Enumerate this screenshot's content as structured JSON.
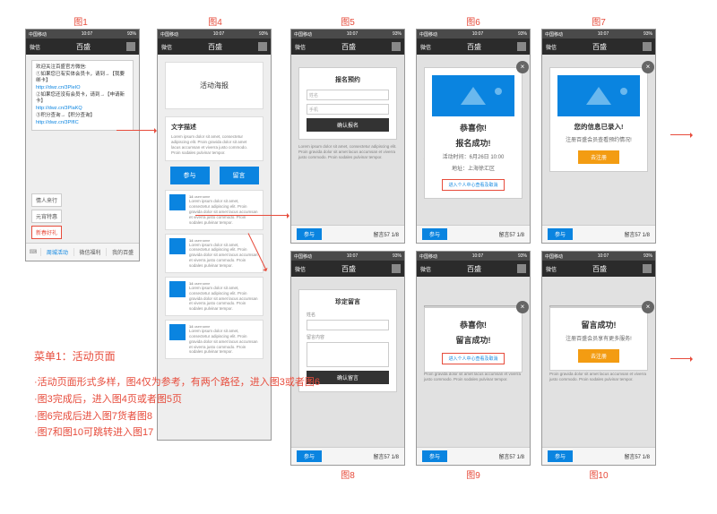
{
  "labels": {
    "f1": "图1",
    "f4": "图4",
    "f5": "图5",
    "f6": "图6",
    "f7": "图7",
    "f8": "图8",
    "f9": "图9",
    "f10": "图10"
  },
  "status": {
    "carrier": "中国移动",
    "time": "10:07",
    "batt": "93%"
  },
  "nav": {
    "back": "微信",
    "title": "百盛"
  },
  "f1": {
    "msg_l1": "欢迎关注百盛官方微信:",
    "msg_l2": "①如果您已有实体会员卡，请到→【我要绑卡】",
    "link1": "http://dwz.cn/3PIeIO",
    "msg_l3": "②如果您还没有会员卡，请到→【申请新卡】",
    "link2": "http://dwz.cn/3PIaKQ",
    "msg_l4": "③积分查询→【积分查询】",
    "link3": "http://dwz.cn/3PIfIC",
    "pill1": "情人来行",
    "pill2": "元宵特惠",
    "pill3": "新春好礼",
    "tab1": "周城活动",
    "tab2": "微信福利",
    "tab3": "我的百盛"
  },
  "f4": {
    "poster": "活动海报",
    "section": "文字描述",
    "btn1": "参与",
    "btn2": "留言",
    "item_hd": "14",
    "item_sub": "username"
  },
  "f5": {
    "title": "报名预约",
    "ph1": "姓名",
    "ph2": "手机",
    "submit": "确认报名"
  },
  "f6": {
    "t1": "恭喜你!",
    "t2": "报名成功!",
    "info": "活动时间：6月26日 10:00",
    "addr": "地址：上海徐汇区",
    "cta": "进入个人中心查看及取消"
  },
  "f7": {
    "t1": "您的信息已录入!",
    "t2": "注册百盛会员查看预约情况!",
    "cta": "去注册"
  },
  "f8": {
    "title": "珍定留言",
    "lbl1": "姓名",
    "lbl2": "留言内容",
    "submit": "确认留言"
  },
  "f9": {
    "t1": "恭喜你!",
    "t2": "留言成功!",
    "cta": "进入个人中心查看及取消"
  },
  "f10": {
    "t1": "留言成功!",
    "t2": "注册百盛会员享有更多服务!",
    "cta": "去注册"
  },
  "shared": {
    "act": "参与",
    "cnt": "留言57 1/8"
  },
  "lorem": "Lorem ipsum dolor sit amet, consectetur adipiscing elit. Proin gravida dolor sit amet lacus accumsan et viverra justo commodo. Proin sodales pulvinar tempor.",
  "notes": {
    "title": "菜单1：活动页面",
    "l1": "·活动页面形式多样，图4仅为参考，有两个路径，进入图3或者图6",
    "l2": "·图3完成后，进入图4页或者图5页",
    "l3": "·图6完成后进入图7货者图8",
    "l4": "·图7和图10可跳转进入图17"
  }
}
